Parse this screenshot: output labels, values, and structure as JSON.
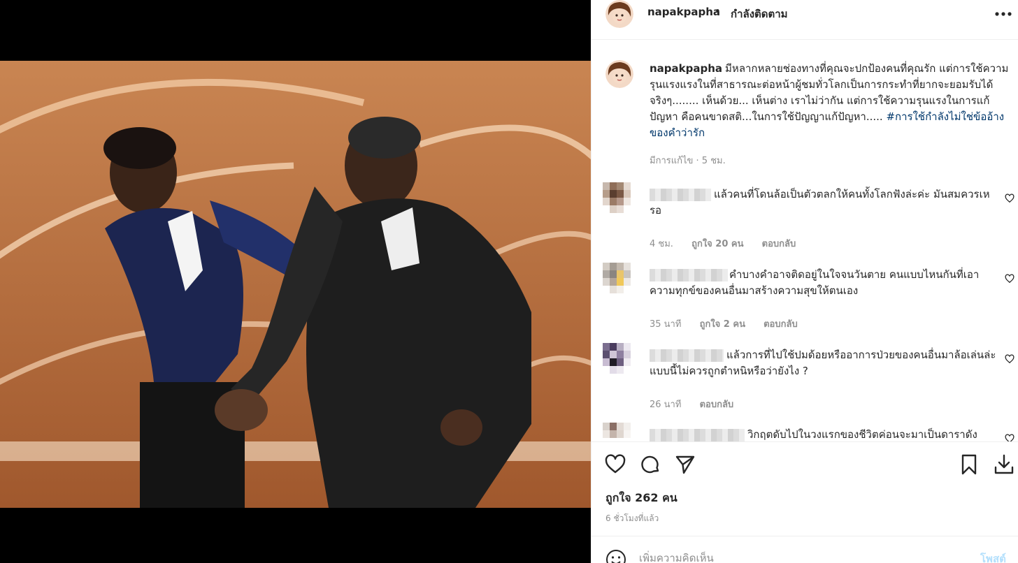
{
  "post": {
    "username": "napakpapha",
    "separator": "•",
    "follow_status": "กำลังติดตาม"
  },
  "caption": {
    "username": "napakpapha",
    "text": "มีหลากหลายช่องทางที่คุณจะปกป้องคนที่คุณรัก แต่การใช้ความรุนแรงแรงในที่สาธารณะต่อหน้าผู้ชมทั่วโลกเป็นการกระทำที่ยากจะยอมรับได้จริงๆ........ เห็นด้วย... เห็นต่าง เราไม่ว่ากัน แต่การใช้ความรุนแรงในการแก้ปัญหา คือคนขาดสติ...ในการใช้ปัญญาแก้ปัญหา.....",
    "hashtag": "#การใช้กำลังไม่ใช่ข้ออ้างของคำว่ารัก",
    "meta": "มีการแก้ไข · 5 ชม."
  },
  "comments": [
    {
      "text": "แล้วคนที่โดนล้อเป็นตัวตลกให้คนทั้งโลกฟังล่ะค่ะ มันสมควรเหรอ",
      "time": "4 ชม.",
      "likes": "ถูกใจ 20 คน",
      "reply": "ตอบกลับ"
    },
    {
      "text": "คำบางคำอาจติดอยู่ในใจจนวันตาย คนแบบไหนกันที่เอาความทุกข์ของคนอื่นมาสร้างความสุขให้ตนเอง",
      "time": "35 นาที",
      "likes": "ถูกใจ 2 คน",
      "reply": "ตอบกลับ"
    },
    {
      "text": "แล้วการที่ไปใช้ปมด้อยหรืออาการป่วยของคนอื่นมาล้อเล่นล่ะ แบบนี้ไม่ควรถูกตำหนิหรือว่ายังไง ?",
      "time": "26 นาที",
      "reply": "ตอบกลับ"
    },
    {
      "text": "วิกฤตดับไปในวงแรกของชีวิตค่อนจะมาเป็นดาราดัง"
    }
  ],
  "actions": {
    "likes": "ถูกใจ 262 คน",
    "time_ago": "6 ชั่วโมงที่แล้ว"
  },
  "add_comment": {
    "placeholder": "เพิ่มความคิดเห็น",
    "post_label": "โพสต์"
  },
  "colors": {
    "hashtag": "#00376b",
    "muted": "#8e8e8e",
    "post_button_disabled": "#b2dffc"
  }
}
